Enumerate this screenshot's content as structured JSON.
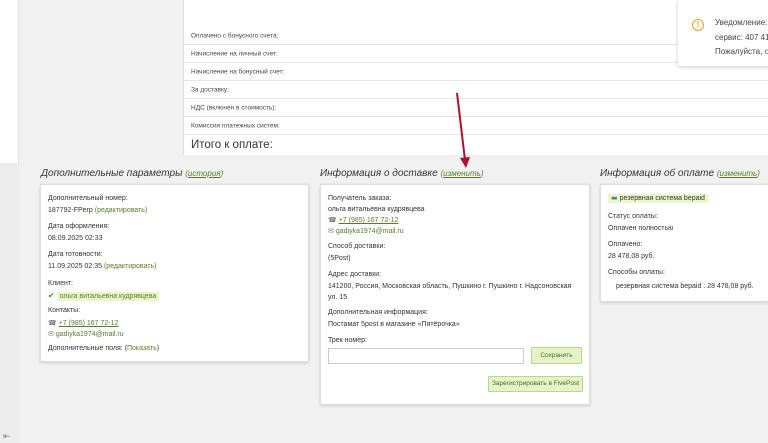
{
  "totals": {
    "rows": [
      {
        "label": "Оплачено с бонусного счета:"
      },
      {
        "label": "Начисление на личный счет:"
      },
      {
        "label": "Начисление на бонусный счет:"
      },
      {
        "label": "За доставку:"
      },
      {
        "label": "НДС (включен в стоимость):"
      },
      {
        "label": "Комиссия платежных систем:"
      }
    ],
    "total_label": "Итого к оплате:"
  },
  "notification": {
    "line1": "Уведомление:",
    "line2": "сервис: 407 41",
    "line3_a": "Пожалуйста, ",
    "line3_b": "с"
  },
  "additional": {
    "title": "Дополнительные параметры",
    "history_link": "история",
    "number_label": "Дополнительный номер:",
    "number_value": "187792-FPerp",
    "edit1": "редактировать",
    "created_label": "Дата оформления:",
    "created_value": "08.09.2025 02:33",
    "ready_label": "Дата готовности:",
    "ready_value": "11.09.2025 02:35",
    "edit2": "редактировать",
    "client_label": "Клиент:",
    "client_value": "ольга витальевна кудрявцева",
    "contacts_label": "Контакты:",
    "phone": "+7 (985) 167 72-12",
    "email": "gadiyka1974@mail.ru",
    "extra_label": "Дополнительные поля: (",
    "extra_link": "Показать",
    "extra_close": ")"
  },
  "delivery": {
    "title": "Информация о доставке",
    "change_link": "изменить",
    "recipient_label": "Получатель заказа:",
    "recipient_name": "ольга витальевна кудрявцева",
    "phone": "+7 (985) 167 72-12",
    "email": "gadiyka1974@mail.ru",
    "method_label": "Способ доставки:",
    "method_value": "(5Post)",
    "address_label": "Адрес доставки:",
    "address_line1": "141200, Россия, Московская область, Пушкино г. Пушкино г. Надсоновская",
    "address_line2": "ул. 15",
    "info_label": "Дополнительная информация:",
    "info_value": "Постамат 5post в магазине «Пятёрочка»",
    "track_label": "Трек номер:",
    "track_value": "",
    "save_button": "Сохранить",
    "register_button": "Зарегистрировать в FivePost"
  },
  "payment": {
    "title": "Информация об оплате",
    "change_link": "изменить",
    "system_badge": "резервная система bepaid",
    "status_label": "Статус оплаты:",
    "status_value": "Оплачен полностью",
    "paid_label": "Оплачено:",
    "paid_value": "28 478,08 руб.",
    "methods_label": "Способы оплаты:",
    "methods_value": "резервная система bepaid : 28 478,08 руб."
  },
  "annotation": {
    "color": "#b0102a"
  }
}
